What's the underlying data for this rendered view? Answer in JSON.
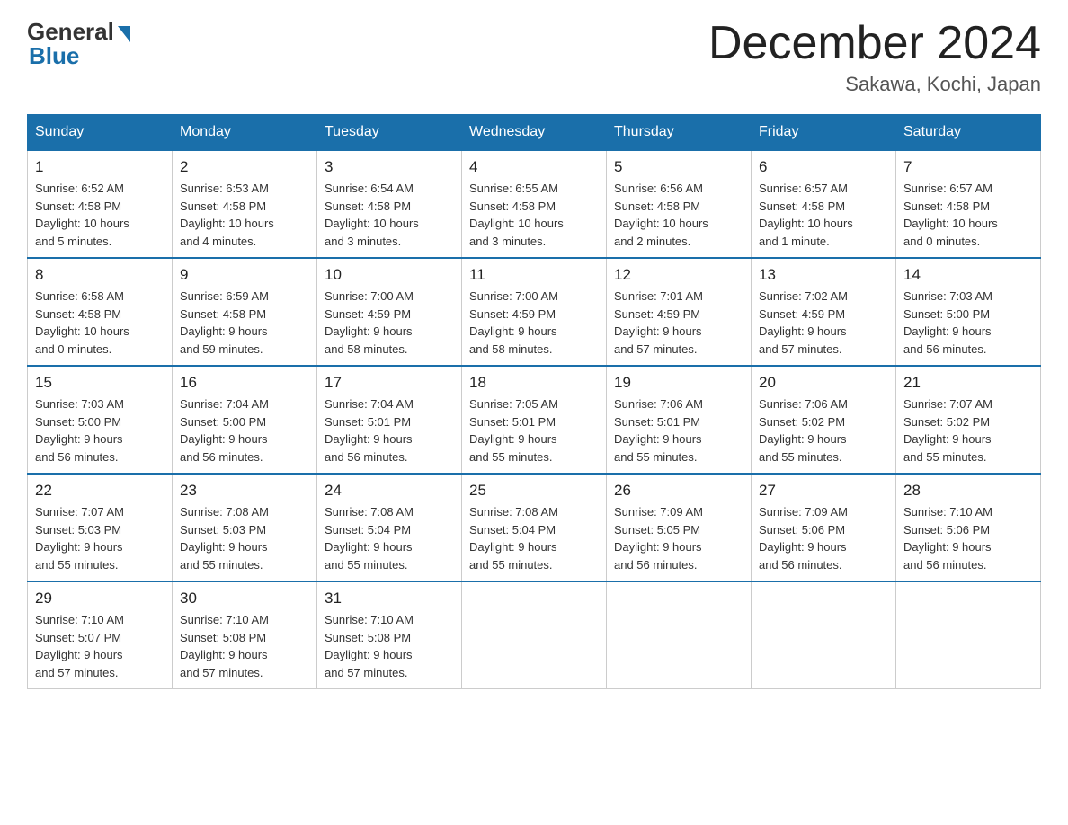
{
  "logo": {
    "general": "General",
    "blue": "Blue"
  },
  "header": {
    "title": "December 2024",
    "location": "Sakawa, Kochi, Japan"
  },
  "weekdays": [
    "Sunday",
    "Monday",
    "Tuesday",
    "Wednesday",
    "Thursday",
    "Friday",
    "Saturday"
  ],
  "weeks": [
    [
      {
        "day": "1",
        "sunrise": "6:52 AM",
        "sunset": "4:58 PM",
        "daylight": "10 hours and 5 minutes."
      },
      {
        "day": "2",
        "sunrise": "6:53 AM",
        "sunset": "4:58 PM",
        "daylight": "10 hours and 4 minutes."
      },
      {
        "day": "3",
        "sunrise": "6:54 AM",
        "sunset": "4:58 PM",
        "daylight": "10 hours and 3 minutes."
      },
      {
        "day": "4",
        "sunrise": "6:55 AM",
        "sunset": "4:58 PM",
        "daylight": "10 hours and 3 minutes."
      },
      {
        "day": "5",
        "sunrise": "6:56 AM",
        "sunset": "4:58 PM",
        "daylight": "10 hours and 2 minutes."
      },
      {
        "day": "6",
        "sunrise": "6:57 AM",
        "sunset": "4:58 PM",
        "daylight": "10 hours and 1 minute."
      },
      {
        "day": "7",
        "sunrise": "6:57 AM",
        "sunset": "4:58 PM",
        "daylight": "10 hours and 0 minutes."
      }
    ],
    [
      {
        "day": "8",
        "sunrise": "6:58 AM",
        "sunset": "4:58 PM",
        "daylight": "10 hours and 0 minutes."
      },
      {
        "day": "9",
        "sunrise": "6:59 AM",
        "sunset": "4:58 PM",
        "daylight": "9 hours and 59 minutes."
      },
      {
        "day": "10",
        "sunrise": "7:00 AM",
        "sunset": "4:59 PM",
        "daylight": "9 hours and 58 minutes."
      },
      {
        "day": "11",
        "sunrise": "7:00 AM",
        "sunset": "4:59 PM",
        "daylight": "9 hours and 58 minutes."
      },
      {
        "day": "12",
        "sunrise": "7:01 AM",
        "sunset": "4:59 PM",
        "daylight": "9 hours and 57 minutes."
      },
      {
        "day": "13",
        "sunrise": "7:02 AM",
        "sunset": "4:59 PM",
        "daylight": "9 hours and 57 minutes."
      },
      {
        "day": "14",
        "sunrise": "7:03 AM",
        "sunset": "5:00 PM",
        "daylight": "9 hours and 56 minutes."
      }
    ],
    [
      {
        "day": "15",
        "sunrise": "7:03 AM",
        "sunset": "5:00 PM",
        "daylight": "9 hours and 56 minutes."
      },
      {
        "day": "16",
        "sunrise": "7:04 AM",
        "sunset": "5:00 PM",
        "daylight": "9 hours and 56 minutes."
      },
      {
        "day": "17",
        "sunrise": "7:04 AM",
        "sunset": "5:01 PM",
        "daylight": "9 hours and 56 minutes."
      },
      {
        "day": "18",
        "sunrise": "7:05 AM",
        "sunset": "5:01 PM",
        "daylight": "9 hours and 55 minutes."
      },
      {
        "day": "19",
        "sunrise": "7:06 AM",
        "sunset": "5:01 PM",
        "daylight": "9 hours and 55 minutes."
      },
      {
        "day": "20",
        "sunrise": "7:06 AM",
        "sunset": "5:02 PM",
        "daylight": "9 hours and 55 minutes."
      },
      {
        "day": "21",
        "sunrise": "7:07 AM",
        "sunset": "5:02 PM",
        "daylight": "9 hours and 55 minutes."
      }
    ],
    [
      {
        "day": "22",
        "sunrise": "7:07 AM",
        "sunset": "5:03 PM",
        "daylight": "9 hours and 55 minutes."
      },
      {
        "day": "23",
        "sunrise": "7:08 AM",
        "sunset": "5:03 PM",
        "daylight": "9 hours and 55 minutes."
      },
      {
        "day": "24",
        "sunrise": "7:08 AM",
        "sunset": "5:04 PM",
        "daylight": "9 hours and 55 minutes."
      },
      {
        "day": "25",
        "sunrise": "7:08 AM",
        "sunset": "5:04 PM",
        "daylight": "9 hours and 55 minutes."
      },
      {
        "day": "26",
        "sunrise": "7:09 AM",
        "sunset": "5:05 PM",
        "daylight": "9 hours and 56 minutes."
      },
      {
        "day": "27",
        "sunrise": "7:09 AM",
        "sunset": "5:06 PM",
        "daylight": "9 hours and 56 minutes."
      },
      {
        "day": "28",
        "sunrise": "7:10 AM",
        "sunset": "5:06 PM",
        "daylight": "9 hours and 56 minutes."
      }
    ],
    [
      {
        "day": "29",
        "sunrise": "7:10 AM",
        "sunset": "5:07 PM",
        "daylight": "9 hours and 57 minutes."
      },
      {
        "day": "30",
        "sunrise": "7:10 AM",
        "sunset": "5:08 PM",
        "daylight": "9 hours and 57 minutes."
      },
      {
        "day": "31",
        "sunrise": "7:10 AM",
        "sunset": "5:08 PM",
        "daylight": "9 hours and 57 minutes."
      },
      null,
      null,
      null,
      null
    ]
  ]
}
